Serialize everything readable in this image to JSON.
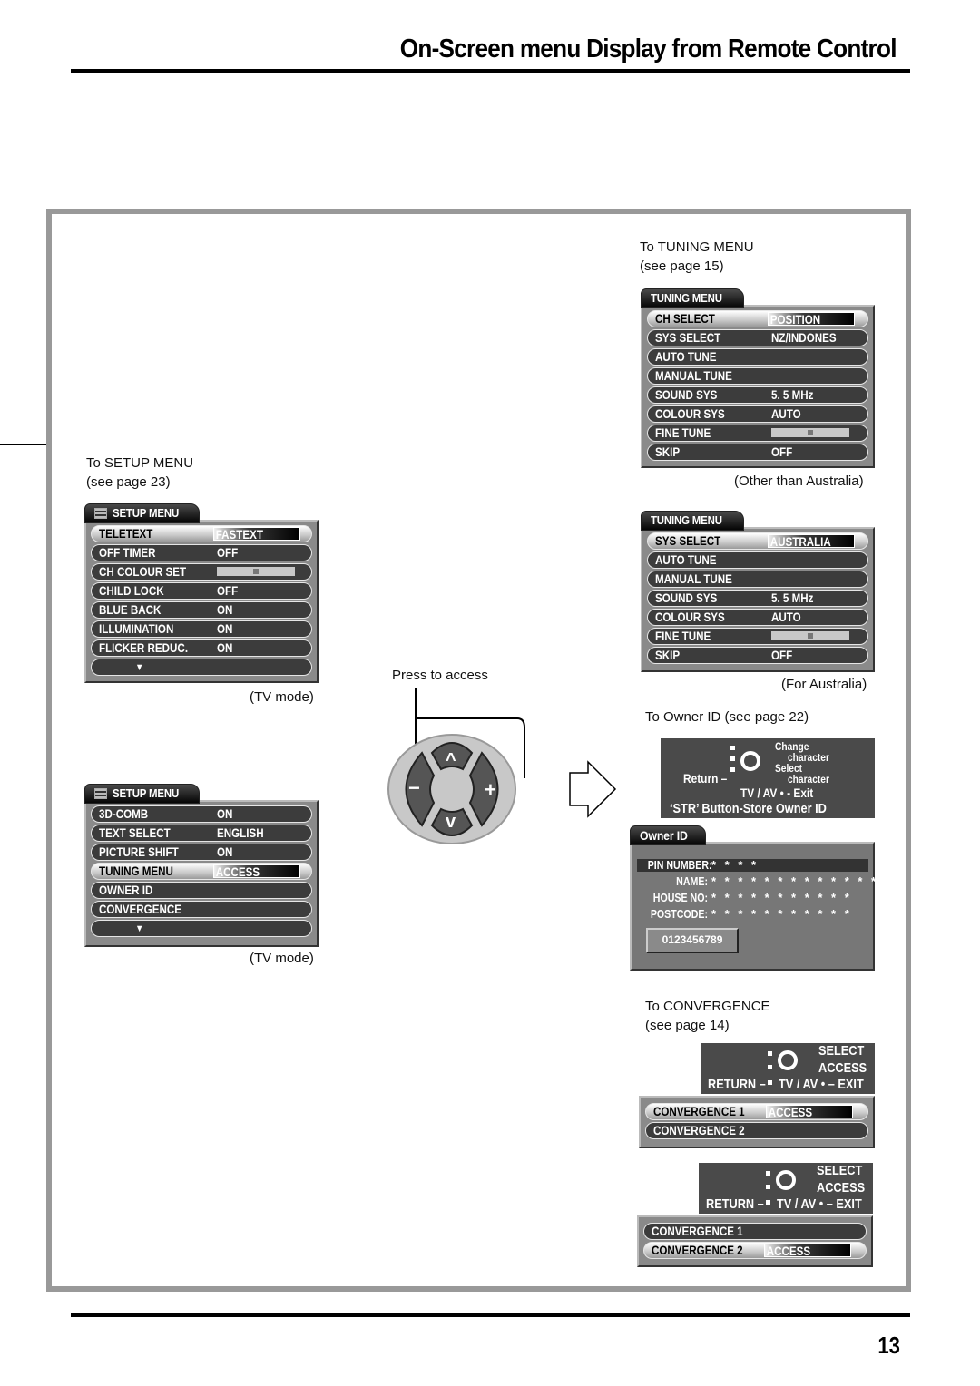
{
  "header": {
    "title": "On-Screen menu Display from Remote Control"
  },
  "page_number": "13",
  "setup_menu_1": {
    "caption_line1": "To SETUP MENU",
    "caption_line2": "(see page 23)",
    "tab": "SETUP  MENU",
    "icon": "menu-list-icon",
    "rows": [
      {
        "label": "TELETEXT",
        "value": "FASTEXT",
        "selected": true
      },
      {
        "label": "OFF  TIMER",
        "value": "OFF"
      },
      {
        "label": "CH  COLOUR  SET",
        "value": "",
        "slider": 0.5
      },
      {
        "label": "CHILD LOCK",
        "value": "OFF"
      },
      {
        "label": "BLUE BACK",
        "value": "ON"
      },
      {
        "label": "ILLUMINATION",
        "value": "ON"
      },
      {
        "label": "FLICKER REDUC.",
        "value": "ON"
      },
      {
        "label": "▼",
        "value": ""
      }
    ],
    "note": "(TV mode)"
  },
  "setup_menu_2": {
    "tab": "SETUP  MENU",
    "rows": [
      {
        "label": "3D-COMB",
        "value": "ON"
      },
      {
        "label": "TEXT  SELECT",
        "value": "ENGLISH"
      },
      {
        "label": "PICTURE  SHIFT",
        "value": "ON"
      },
      {
        "label": "TUNING MENU",
        "value": "ACCESS",
        "selected": true
      },
      {
        "label": "OWNER ID",
        "value": ""
      },
      {
        "label": "CONVERGENCE",
        "value": ""
      },
      {
        "label": "▼",
        "value": ""
      }
    ],
    "note": "(TV mode)"
  },
  "tuning_menu_1": {
    "caption_line1": "To TUNING MENU",
    "caption_line2": "(see page 15)",
    "tab": "TUNING  MENU",
    "rows": [
      {
        "label": "CH SELECT",
        "value": "POSITION",
        "selected": true
      },
      {
        "label": "SYS SELECT",
        "value": "NZ/INDONES"
      },
      {
        "label": "AUTO  TUNE",
        "value": ""
      },
      {
        "label": "MANUAL  TUNE",
        "value": ""
      },
      {
        "label": "SOUND  SYS",
        "value": "5. 5 MHz"
      },
      {
        "label": "COLOUR  SYS",
        "value": "AUTO"
      },
      {
        "label": "FINE  TUNE",
        "value": "",
        "slider": 0.5
      },
      {
        "label": "SKIP",
        "value": "OFF"
      }
    ],
    "note": "(Other than Australia)"
  },
  "tuning_menu_2": {
    "tab": "TUNING  MENU",
    "rows": [
      {
        "label": "SYS SELECT",
        "value": "AUSTRALIA",
        "selected": true
      },
      {
        "label": "AUTO  TUNE",
        "value": ""
      },
      {
        "label": "MANUAL  TUNE",
        "value": ""
      },
      {
        "label": "SOUND  SYS",
        "value": "5. 5 MHz"
      },
      {
        "label": "COLOUR  SYS",
        "value": "AUTO"
      },
      {
        "label": "FINE  TUNE",
        "value": "",
        "slider": 0.5
      },
      {
        "label": "SKIP",
        "value": "OFF"
      }
    ],
    "note": "(For Australia)"
  },
  "remote": {
    "caption": "Press to access",
    "buttons": {
      "minus": "−",
      "plus": "+",
      "up": "^",
      "down": "v"
    }
  },
  "owner_id": {
    "caption": "To Owner ID (see page 22)",
    "help": {
      "change": "Change",
      "character1": "character",
      "select": "Select",
      "character2": "character",
      "return": "Return –",
      "exit": "TV / AV • - Exit",
      "store": "‘STR’ Button-Store Owner ID"
    },
    "tab": "Owner ID",
    "fields": [
      {
        "label": "PIN NUMBER:",
        "value": "* * * *",
        "highlighted": true
      },
      {
        "label": "NAME:",
        "value": "* * * * * * * * * * * * * *"
      },
      {
        "label": "HOUSE NO:",
        "value": "* * * * * * * * * * *"
      },
      {
        "label": "POSTCODE:",
        "value": "* * * * * * * * * * *"
      }
    ],
    "digits": "0123456789"
  },
  "convergence": {
    "caption_line1": "To CONVERGENCE",
    "caption_line2": "(see page 14)",
    "help": {
      "select": "SELECT",
      "access": "ACCESS",
      "return": "RETURN –",
      "exit": "TV / AV • – EXIT"
    },
    "menu_1": [
      {
        "label": "CONVERGENCE  1",
        "value": "ACCESS",
        "selected": true
      },
      {
        "label": "CONVERGENCE  2",
        "value": ""
      }
    ],
    "menu_2": [
      {
        "label": "CONVERGENCE  1",
        "value": ""
      },
      {
        "label": "CONVERGENCE  2",
        "value": "ACCESS",
        "selected": true
      }
    ]
  }
}
